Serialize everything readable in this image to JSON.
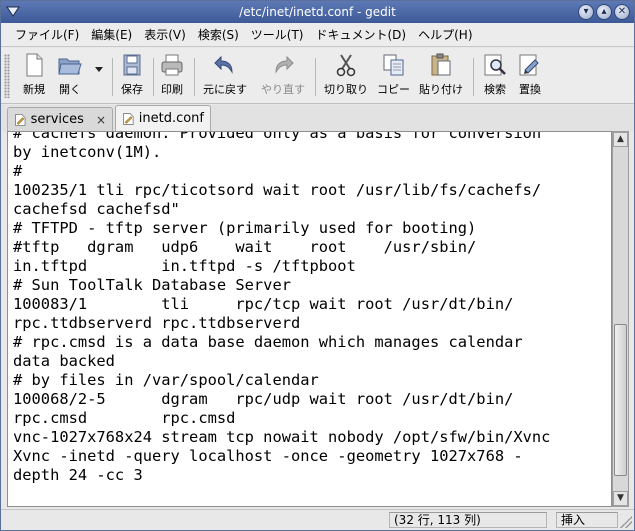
{
  "window": {
    "title": "/etc/inet/inetd.conf - gedit"
  },
  "menubar": [
    "ファイル(F)",
    "編集(E)",
    "表示(V)",
    "検索(S)",
    "ツール(T)",
    "ドキュメント(D)",
    "ヘルプ(H)"
  ],
  "toolbar": {
    "new": "新規",
    "open": "開く",
    "save": "保存",
    "print": "印刷",
    "undo": "元に戻す",
    "redo": "やり直す",
    "cut": "切り取り",
    "copy": "コピー",
    "paste": "貼り付け",
    "find": "検索",
    "replace": "置換"
  },
  "tabs": [
    {
      "label": "services",
      "close": "×"
    },
    {
      "label": "inetd.conf",
      "close": ""
    }
  ],
  "editor": {
    "lines": [
      "# cachefs daemon. Provided only as a basis for conversion",
      "by inetconv(1M).",
      "#",
      "100235/1 tli rpc/ticotsord wait root /usr/lib/fs/cachefs/",
      "cachefsd cachefsd\"",
      "# TFTPD - tftp server (primarily used for booting)",
      "#tftp   dgram   udp6    wait    root    /usr/sbin/",
      "in.tftpd        in.tftpd -s /tftpboot",
      "# Sun ToolTalk Database Server",
      "100083/1        tli     rpc/tcp wait root /usr/dt/bin/",
      "rpc.ttdbserverd rpc.ttdbserverd",
      "# rpc.cmsd is a data base daemon which manages calendar",
      "data backed",
      "# by files in /var/spool/calendar",
      "100068/2-5      dgram   rpc/udp wait root /usr/dt/bin/",
      "rpc.cmsd        rpc.cmsd",
      "vnc-1027x768x24 stream tcp nowait nobody /opt/sfw/bin/Xvnc",
      "Xvnc -inetd -query localhost -once -geometry 1027x768 -",
      "depth 24 -cc 3",
      ""
    ]
  },
  "statusbar": {
    "position": "(32 行, 113 列)",
    "mode": "挿入"
  }
}
